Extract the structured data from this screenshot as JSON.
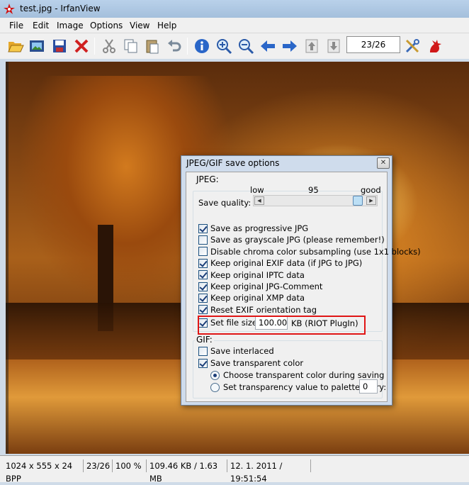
{
  "window": {
    "title": "test.jpg - IrfanView"
  },
  "menu": [
    "File",
    "Edit",
    "Image",
    "Options",
    "View",
    "Help"
  ],
  "toolbar": {
    "buttons": [
      "open-folder",
      "slideshow",
      "save",
      "delete",
      "cut",
      "copy",
      "paste",
      "undo",
      "info",
      "zoom-in",
      "zoom-out",
      "previous",
      "next",
      "first-page",
      "last-page",
      "settings",
      "exit"
    ],
    "counter": "23/26"
  },
  "status": {
    "dimensions": "1024 x 555 x 24 BPP",
    "index": "23/26",
    "zoom": "100 %",
    "size": "109.46 KB / 1.63 MB",
    "datetime": "12. 1. 2011 / 19:51:54"
  },
  "dialog": {
    "title": "JPEG/GIF save options",
    "jpeg": {
      "group_label": "JPEG:",
      "quality_label": "Save quality:",
      "low": "low",
      "value": "95",
      "good": "good",
      "quality": 95,
      "options": [
        {
          "label": "Save as progressive JPG",
          "checked": true
        },
        {
          "label": "Save as grayscale JPG (please remember!)",
          "checked": false
        },
        {
          "label": "Disable chroma color subsampling (use 1x1 blocks)",
          "checked": false
        },
        {
          "label": "Keep original EXIF data (if JPG to JPG)",
          "checked": true
        },
        {
          "label": "Keep original IPTC data",
          "checked": true
        },
        {
          "label": "Keep original JPG-Comment",
          "checked": true
        },
        {
          "label": "Keep original XMP data",
          "checked": true
        },
        {
          "label": "Reset EXIF orientation tag",
          "checked": true
        }
      ],
      "file_size": {
        "label": "Set file size:",
        "value": "100.00",
        "unit": "KB (RIOT PlugIn)",
        "checked": true
      }
    },
    "gif": {
      "group_label": "GIF:",
      "interlaced": {
        "label": "Save interlaced",
        "checked": false
      },
      "transparent": {
        "label": "Save transparent color",
        "checked": true
      },
      "choose": {
        "label": "Choose transparent color during saving",
        "selected": true
      },
      "set_value": {
        "label": "Set transparency value to palette entry:",
        "selected": false,
        "value": "0"
      }
    }
  }
}
